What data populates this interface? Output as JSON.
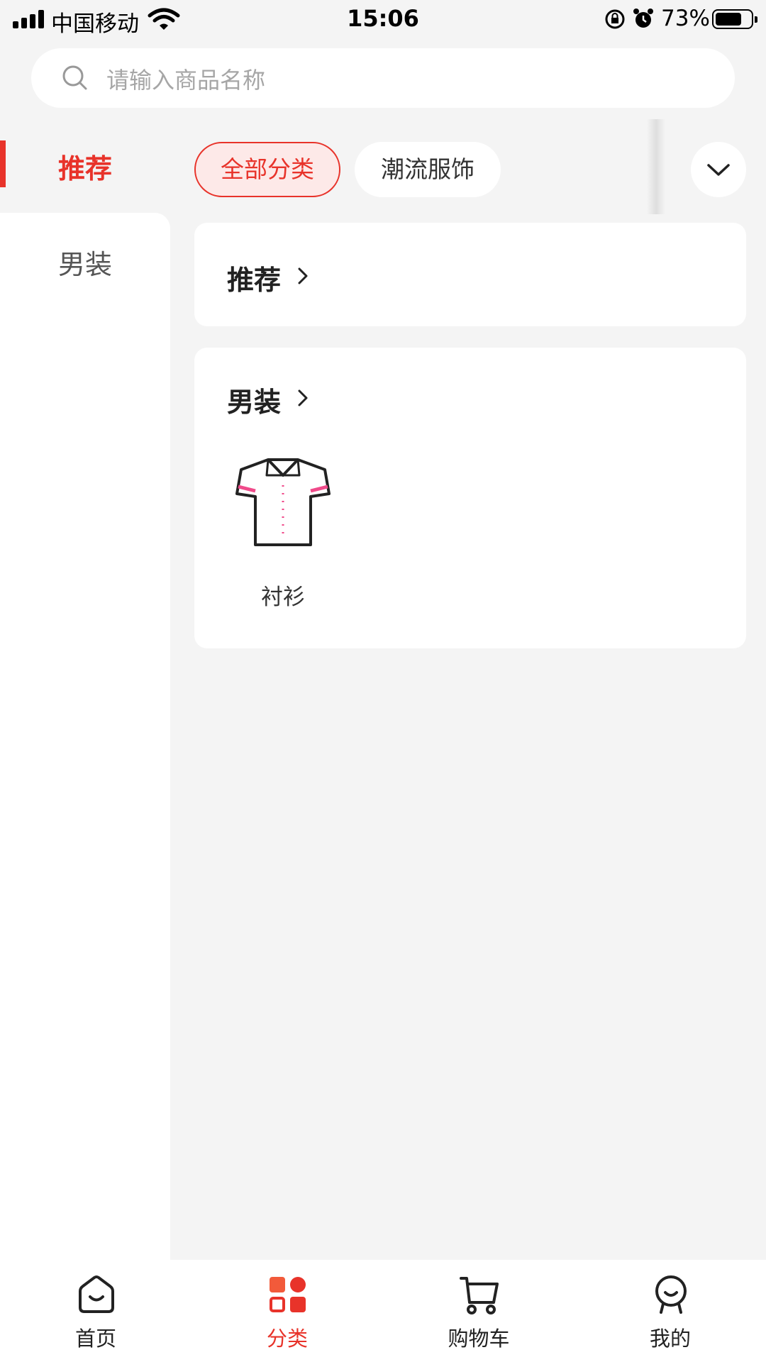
{
  "status_bar": {
    "carrier": "中国移动",
    "time": "15:06",
    "battery_percent": "73%",
    "battery_level": 0.73,
    "icons": [
      "signal-icon",
      "wifi-icon",
      "rotation-lock-icon",
      "alarm-icon",
      "battery-icon"
    ]
  },
  "search": {
    "placeholder": "请输入商品名称",
    "icon": "search-icon"
  },
  "sidebar": {
    "items": [
      {
        "label": "推荐",
        "active": true
      },
      {
        "label": "男装",
        "active": false
      }
    ]
  },
  "chips": {
    "items": [
      {
        "label": "全部分类",
        "active": true
      },
      {
        "label": "潮流服饰",
        "active": false
      }
    ],
    "expand_icon": "chevron-down-icon"
  },
  "sections": [
    {
      "title": "推荐",
      "items": []
    },
    {
      "title": "男装",
      "items": [
        {
          "label": "衬衫",
          "icon": "shirt-icon"
        }
      ]
    }
  ],
  "bottom_nav": {
    "items": [
      {
        "label": "首页",
        "icon": "home-icon",
        "active": false
      },
      {
        "label": "分类",
        "icon": "category-icon",
        "active": true
      },
      {
        "label": "购物车",
        "icon": "cart-icon",
        "active": false
      },
      {
        "label": "我的",
        "icon": "profile-icon",
        "active": false
      }
    ]
  },
  "colors": {
    "accent": "#e8332a",
    "accent_light": "#fde9e8",
    "background": "#f4f4f4",
    "card": "#ffffff"
  }
}
